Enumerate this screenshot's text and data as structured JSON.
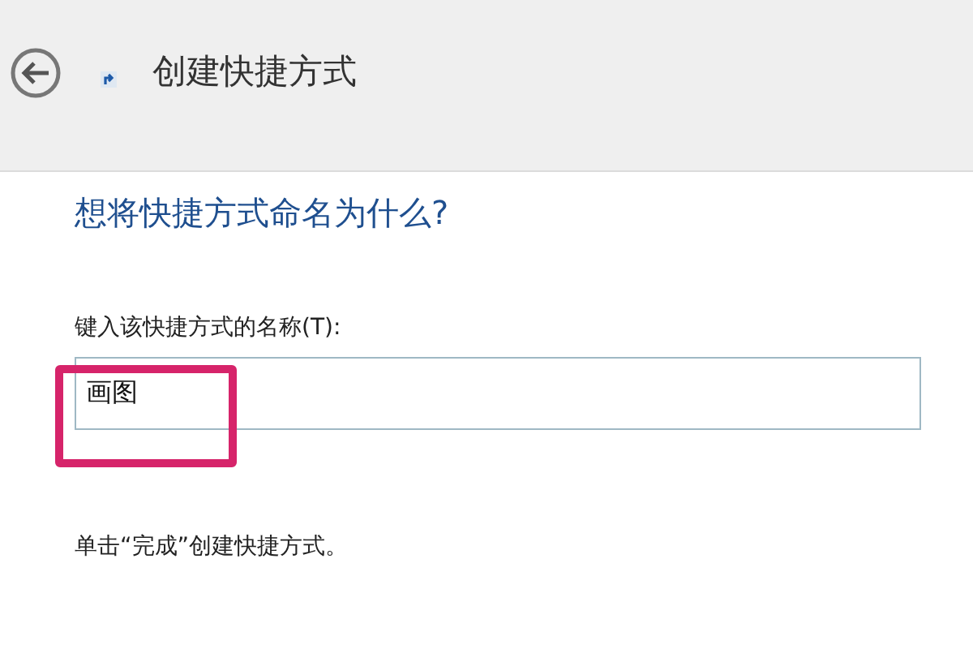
{
  "window": {
    "title": "创建快捷方式"
  },
  "heading": "想将快捷方式命名为什么?",
  "name_field": {
    "label": "键入该快捷方式的名称(T):",
    "value": "画图",
    "highlighted": true
  },
  "instruction": "单击“完成”创建快捷方式。"
}
